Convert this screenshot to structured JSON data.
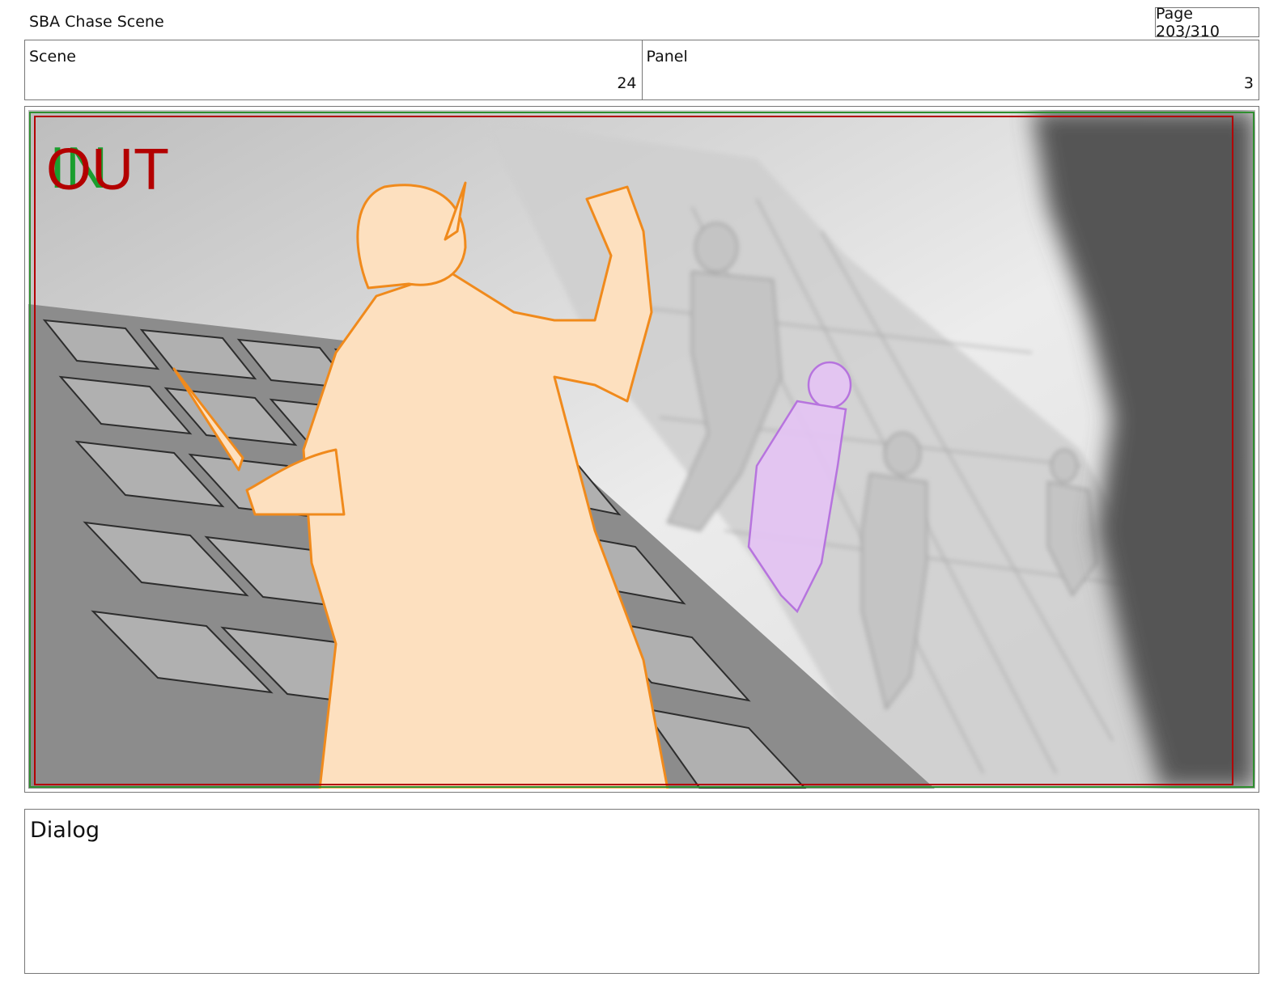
{
  "header": {
    "doc_title": "SBA Chase Scene",
    "page_label": "Page 203/310"
  },
  "info": {
    "scene_label": "Scene",
    "scene_value": "24",
    "panel_label": "Panel",
    "panel_value": "3"
  },
  "panel": {
    "marker_in": "IN",
    "marker_out": "OUT",
    "colors": {
      "in_marker": "#1a9e2e",
      "out_marker": "#b30000",
      "hero_fill": "#fde0bf",
      "hero_line": "#f08a1c",
      "fairy_fill": "#e5c4f5",
      "fairy_line": "#b46ae0",
      "roof_tile": "#8c8c8c",
      "sky": "#f2f2f2"
    }
  },
  "dialog": {
    "label": "Dialog"
  }
}
